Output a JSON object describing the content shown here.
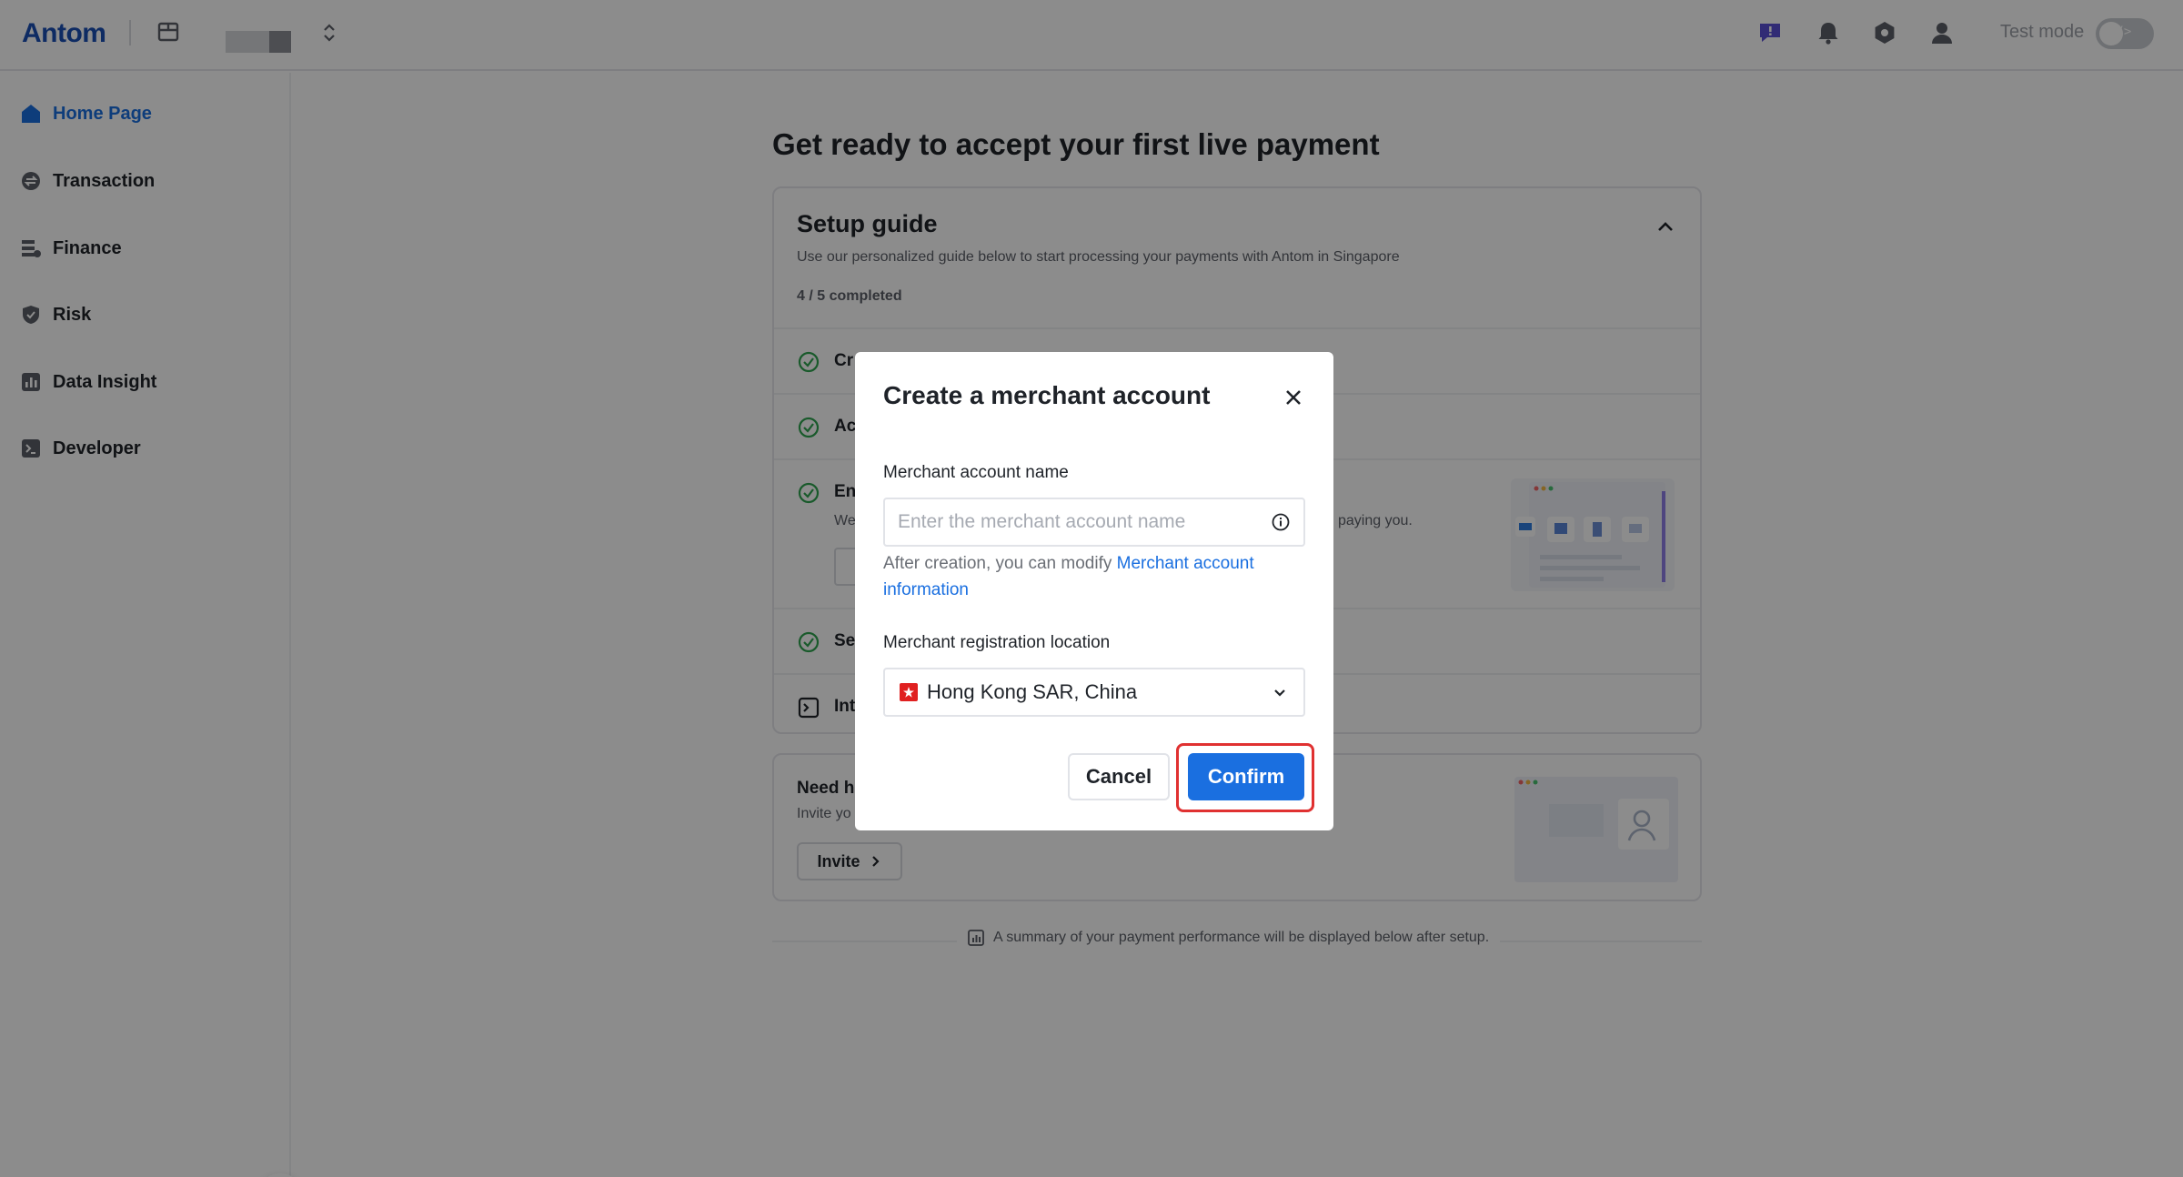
{
  "header": {
    "logo": "Antom",
    "test_mode_label": "Test mode",
    "test_mode_toggle_text": "</>"
  },
  "sidebar": {
    "items": [
      {
        "label": "Home Page",
        "icon": "home-icon",
        "active": true
      },
      {
        "label": "Transaction",
        "icon": "transaction-icon",
        "active": false
      },
      {
        "label": "Finance",
        "icon": "finance-icon",
        "active": false
      },
      {
        "label": "Risk",
        "icon": "shield-icon",
        "active": false
      },
      {
        "label": "Data Insight",
        "icon": "chart-icon",
        "active": false
      },
      {
        "label": "Developer",
        "icon": "terminal-icon",
        "active": false
      }
    ]
  },
  "main": {
    "page_title": "Get ready to accept your first live payment",
    "setup_guide": {
      "title": "Setup guide",
      "subtitle": "Use our personalized guide below to start processing your payments with Antom in Singapore",
      "progress": "4 / 5 completed",
      "steps": [
        {
          "title_visible": "Cr"
        },
        {
          "title_visible": "Ac"
        },
        {
          "title_visible": "En",
          "desc_visible": "We",
          "desc_right_visible": "paying you."
        },
        {
          "title_visible": "Se"
        },
        {
          "title_visible": "Int"
        }
      ]
    },
    "help_card": {
      "title_visible": "Need h",
      "desc_visible": "Invite yo",
      "invite_label": "Invite"
    },
    "summary": "A summary of your payment performance will be displayed below after setup."
  },
  "modal": {
    "title": "Create a merchant account",
    "name_label": "Merchant account name",
    "name_placeholder": "Enter the merchant account name",
    "name_value": "",
    "help_prefix": "After creation, you can modify ",
    "help_link": "Merchant account information",
    "location_label": "Merchant registration location",
    "location_value": "Hong Kong SAR, China",
    "cancel_label": "Cancel",
    "confirm_label": "Confirm"
  },
  "colors": {
    "brand": "#1a4fb5",
    "primary": "#1a6fe0",
    "success": "#2ea44f",
    "highlight": "#e03131"
  }
}
